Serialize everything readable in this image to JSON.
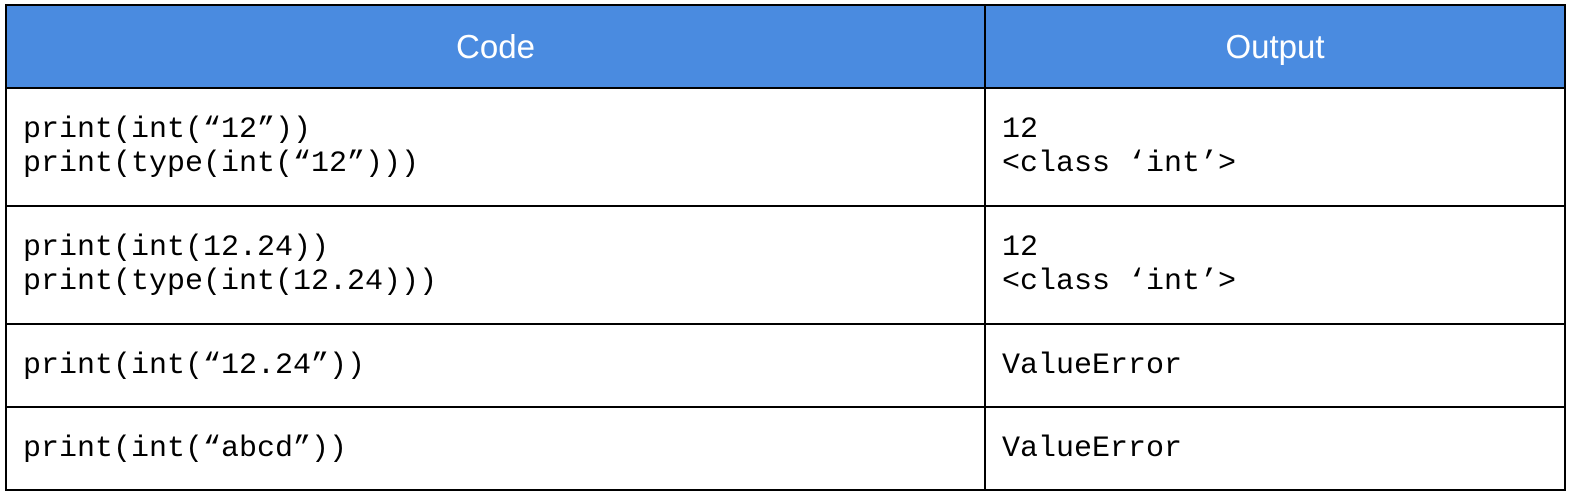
{
  "header": {
    "code": "Code",
    "output": "Output"
  },
  "rows": [
    {
      "code": [
        "print(int(“12”))",
        "print(type(int(“12”)))"
      ],
      "output": [
        "12",
        "<class ‘int’>"
      ]
    },
    {
      "code": [
        "print(int(12.24))",
        "print(type(int(12.24)))"
      ],
      "output": [
        "12",
        "<class ‘int’>"
      ]
    },
    {
      "code": [
        "print(int(“12.24”))"
      ],
      "output": [
        "ValueError"
      ]
    },
    {
      "code": [
        "print(int(“abcd”))"
      ],
      "output": [
        "ValueError"
      ]
    }
  ],
  "colors": {
    "header_bg": "#4a8be0",
    "header_text": "#ffffff",
    "border": "#000000"
  }
}
